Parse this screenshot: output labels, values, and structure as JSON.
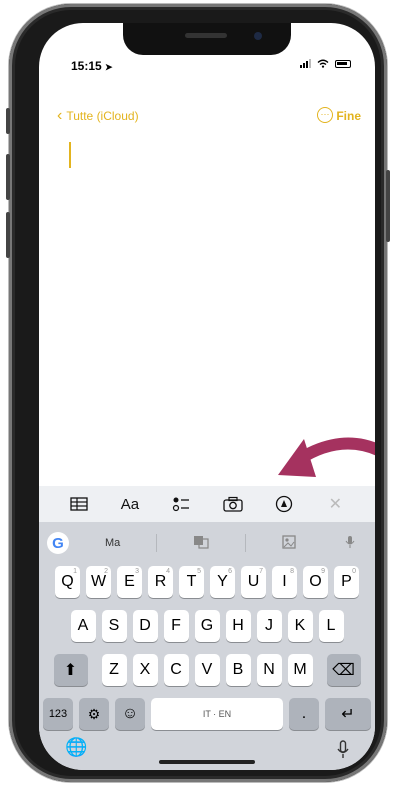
{
  "status": {
    "time": "15:15"
  },
  "nav": {
    "back_label": "Tutte (iCloud)",
    "done_label": "Fine",
    "more_glyph": "···"
  },
  "toolbar": {
    "table_icon": "table-icon",
    "format_label": "Aa",
    "checklist_icon": "checklist-icon",
    "camera_icon": "camera-icon",
    "markup_icon": "markup-icon",
    "close_glyph": "✕"
  },
  "suggestions": {
    "google": "G",
    "word": "Ma"
  },
  "keyboard": {
    "row1": [
      {
        "k": "Q",
        "h": "1"
      },
      {
        "k": "W",
        "h": "2"
      },
      {
        "k": "E",
        "h": "3"
      },
      {
        "k": "R",
        "h": "4"
      },
      {
        "k": "T",
        "h": "5"
      },
      {
        "k": "Y",
        "h": "6"
      },
      {
        "k": "U",
        "h": "7"
      },
      {
        "k": "I",
        "h": "8"
      },
      {
        "k": "O",
        "h": "9"
      },
      {
        "k": "P",
        "h": "0"
      }
    ],
    "row2": [
      "A",
      "S",
      "D",
      "F",
      "G",
      "H",
      "J",
      "K",
      "L"
    ],
    "row3": [
      "Z",
      "X",
      "C",
      "V",
      "B",
      "N",
      "M"
    ],
    "numbers_label": "123",
    "space_label": "IT · EN",
    "period_label": ".",
    "return_glyph": "↵",
    "shift_glyph": "⬆",
    "delete_glyph": "⌫",
    "settings_glyph": "⚙",
    "emoji_glyph": "☺",
    "globe_glyph": "🌐"
  },
  "colors": {
    "accent": "#e3b41f",
    "arrow": "#a5325f"
  }
}
